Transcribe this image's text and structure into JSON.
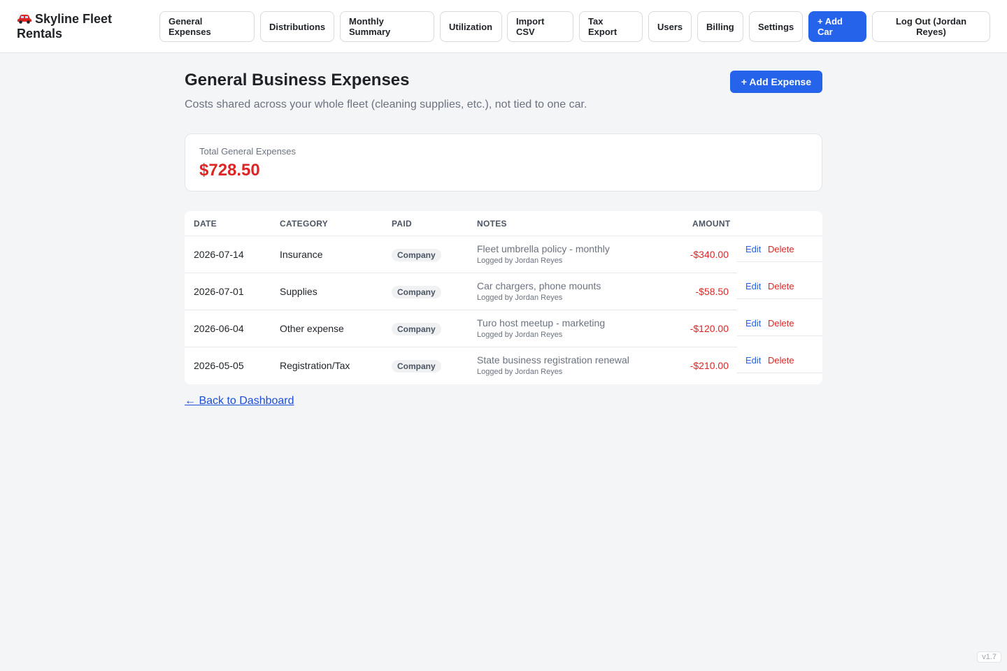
{
  "header": {
    "brand_line1": "Skyline Fleet",
    "brand_line2": "Rentals",
    "brand_icon": "car-icon",
    "nav": {
      "general_expenses": "General Expenses",
      "distributions": "Distributions",
      "monthly_summary": "Monthly Summary",
      "utilization": "Utilization",
      "import_csv": "Import CSV",
      "tax_export": "Tax Export",
      "users": "Users",
      "billing": "Billing",
      "settings": "Settings",
      "add_car": "+ Add Car",
      "logout": "Log Out (Jordan Reyes)"
    }
  },
  "main": {
    "title": "General Business Expenses",
    "subtitle": "Costs shared across your whole fleet (cleaning supplies, etc.), not tied to one car.",
    "add_expense_label": "+ Add Expense",
    "total": {
      "label": "Total General Expenses",
      "value": "$728.50"
    },
    "table": {
      "columns": [
        "Date",
        "Category",
        "Paid",
        "Notes",
        "Amount"
      ],
      "rows": [
        {
          "date": "2026-07-14",
          "category": "Insurance",
          "paid": "Company",
          "note": "Fleet umbrella policy - monthly",
          "logged": "Logged by Jordan Reyes",
          "amount": "-$340.00",
          "edit": "Edit",
          "delete": "Delete"
        },
        {
          "date": "2026-07-01",
          "category": "Supplies",
          "paid": "Company",
          "note": "Car chargers, phone mounts",
          "logged": "Logged by Jordan Reyes",
          "amount": "-$58.50",
          "edit": "Edit",
          "delete": "Delete"
        },
        {
          "date": "2026-06-04",
          "category": "Other expense",
          "paid": "Company",
          "note": "Turo host meetup - marketing",
          "logged": "Logged by Jordan Reyes",
          "amount": "-$120.00",
          "edit": "Edit",
          "delete": "Delete"
        },
        {
          "date": "2026-05-05",
          "category": "Registration/Tax",
          "paid": "Company",
          "note": "State business registration renewal",
          "logged": "Logged by Jordan Reyes",
          "amount": "-$210.00",
          "edit": "Edit",
          "delete": "Delete"
        }
      ]
    },
    "back_link": "← Back to Dashboard"
  },
  "footer": {
    "version": "v1.7"
  },
  "colors": {
    "primary": "#2563eb",
    "negative": "#dc2626",
    "background": "#f4f5f7"
  }
}
